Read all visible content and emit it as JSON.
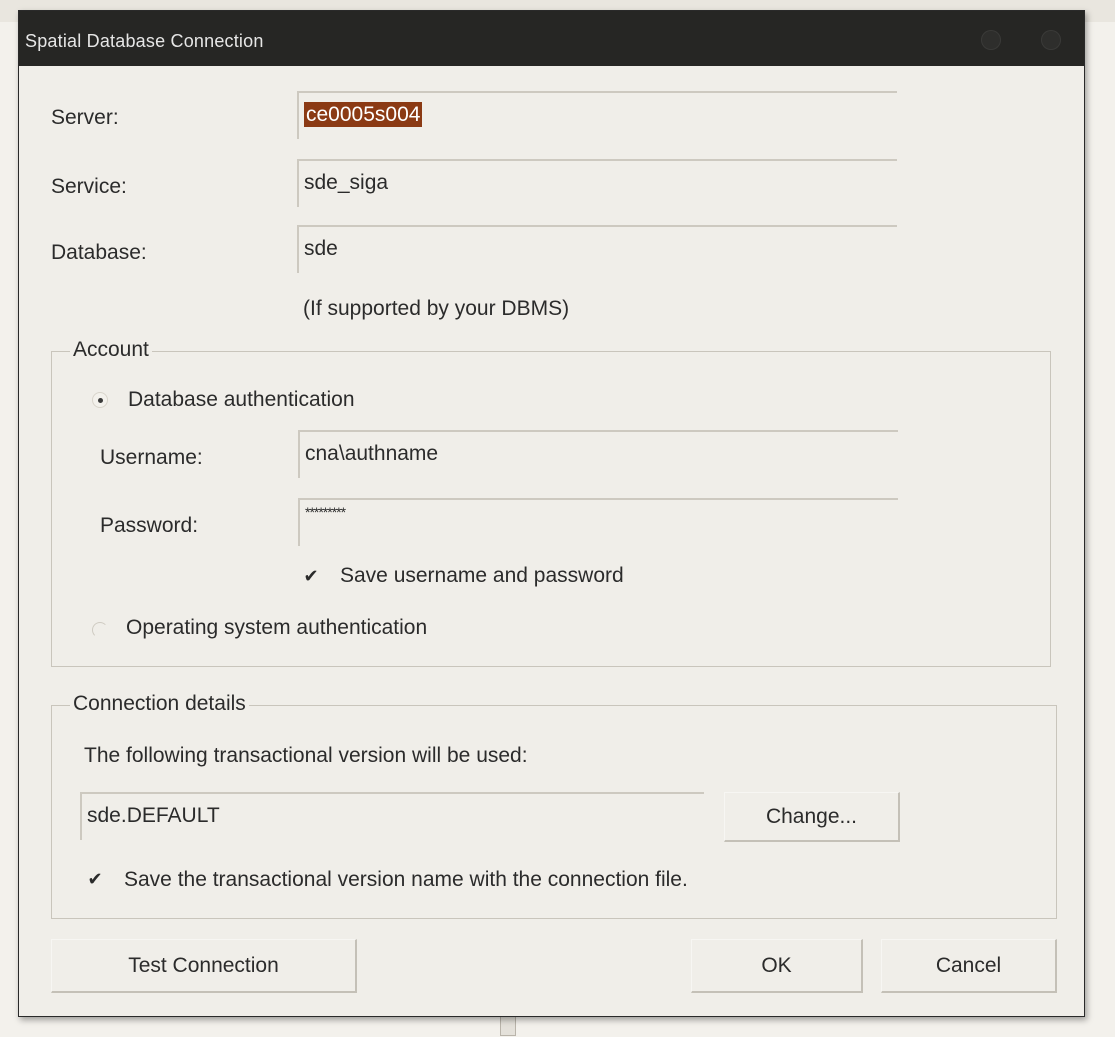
{
  "dialog": {
    "title": "Spatial Database Connection",
    "server_label": "Server:",
    "server_value": "ce0005s004",
    "service_label": "Service:",
    "service_value": "sde_siga",
    "database_label": "Database:",
    "database_value": "sde",
    "database_note": "(If supported by your DBMS)"
  },
  "account": {
    "legend": "Account",
    "db_auth_label": "Database authentication",
    "db_auth_selected": true,
    "username_label": "Username:",
    "username_value": "cna\\authname",
    "password_label": "Password:",
    "password_value": "*********",
    "save_credentials_label": "Save username and password",
    "save_credentials_checked": true,
    "os_auth_label": "Operating system authentication",
    "os_auth_selected": false
  },
  "connection_details": {
    "legend": "Connection details",
    "description": "The following transactional version will be used:",
    "version_value": "sde.DEFAULT",
    "change_button": "Change...",
    "save_version_label": "Save the transactional version name with the connection file.",
    "save_version_checked": true
  },
  "buttons": {
    "test_connection": "Test Connection",
    "ok": "OK",
    "cancel": "Cancel"
  },
  "colors": {
    "titlebar": "#262624",
    "dialog_bg": "#f0eee9",
    "selection": "#8b3a14"
  }
}
